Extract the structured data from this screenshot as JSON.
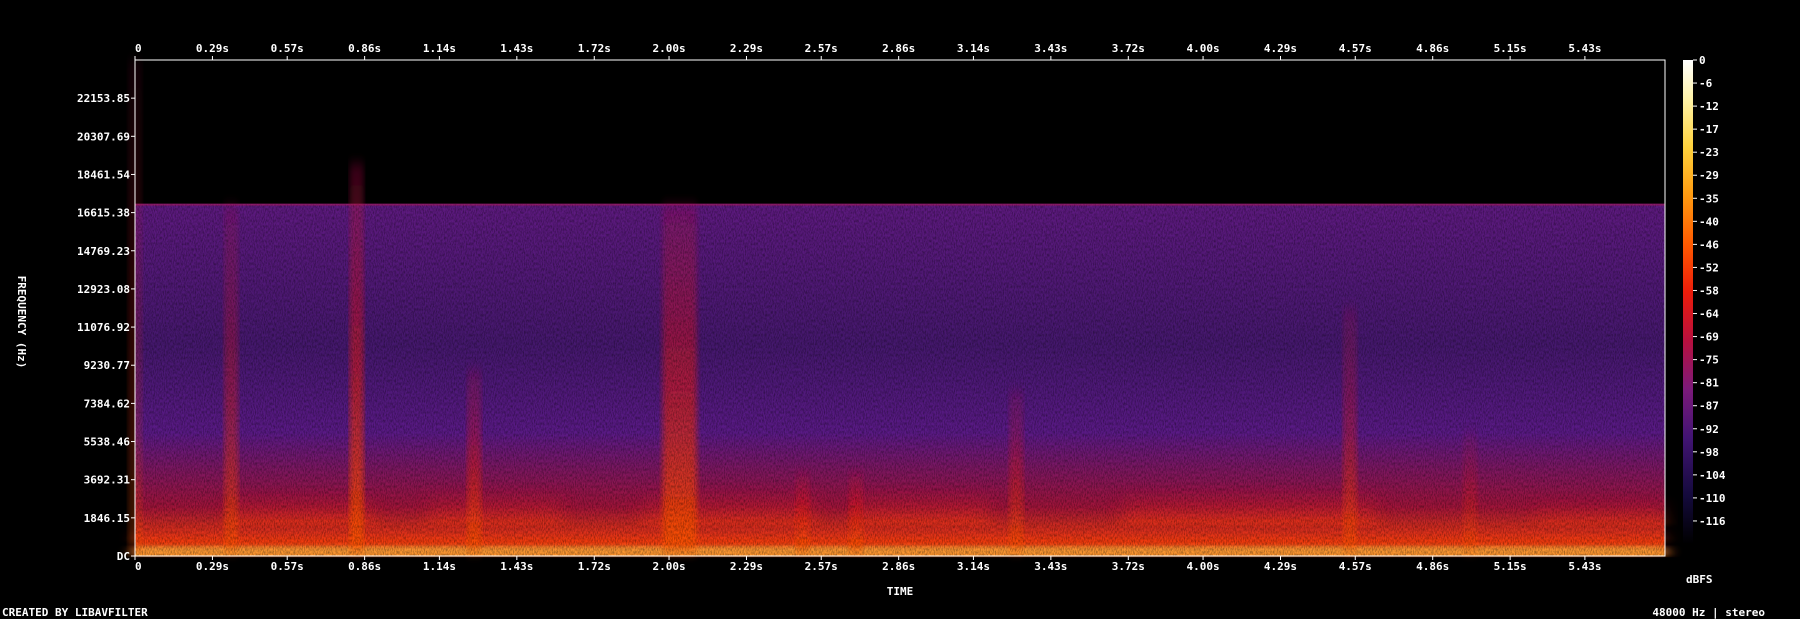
{
  "chart_data": {
    "type": "heatmap",
    "subtype": "spectrogram",
    "xlabel": "TIME",
    "ylabel": "FREQUENCY (Hz)",
    "x_ticks": [
      "0",
      "0.29s",
      "0.57s",
      "0.86s",
      "1.14s",
      "1.43s",
      "1.72s",
      "2.00s",
      "2.29s",
      "2.57s",
      "2.86s",
      "3.14s",
      "3.43s",
      "3.72s",
      "4.00s",
      "4.29s",
      "4.57s",
      "4.86s",
      "5.15s",
      "5.43s"
    ],
    "y_ticks": [
      "DC",
      "1846.15",
      "3692.31",
      "5538.46",
      "7384.62",
      "9230.77",
      "11076.92",
      "12923.08",
      "14769.23",
      "16615.38",
      "18461.54",
      "20307.69",
      "22153.85"
    ],
    "xlim": [
      0,
      5.73
    ],
    "ylim": [
      0,
      24000
    ],
    "cutoff_hz": 17000,
    "colorbar": {
      "label": "dBFS",
      "ticks": [
        "0",
        "-6",
        "-12",
        "-17",
        "-23",
        "-29",
        "-35",
        "-40",
        "-46",
        "-52",
        "-58",
        "-64",
        "-69",
        "-75",
        "-81",
        "-87",
        "-92",
        "-98",
        "-104",
        "-110",
        "-116"
      ],
      "colors": [
        "#ffffff",
        "#fff3a8",
        "#ffd23c",
        "#ff9a10",
        "#ff5a00",
        "#ec1c0a",
        "#b8103e",
        "#7c1a7a",
        "#421474",
        "#140a3c",
        "#000000"
      ]
    },
    "events": [
      {
        "t": 0.0,
        "fmax": 24000,
        "level": -60
      },
      {
        "t": 0.36,
        "fmax": 17000,
        "level": -50
      },
      {
        "t": 0.83,
        "fmax": 19000,
        "level": -40
      },
      {
        "t": 1.27,
        "fmax": 9000,
        "level": -45
      },
      {
        "t": 2.04,
        "fmax": 17000,
        "level": -40
      },
      {
        "t": 2.5,
        "fmax": 4000,
        "level": -40
      },
      {
        "t": 2.7,
        "fmax": 4000,
        "level": -38
      },
      {
        "t": 3.3,
        "fmax": 8000,
        "level": -50
      },
      {
        "t": 4.55,
        "fmax": 12000,
        "level": -50
      },
      {
        "t": 5.0,
        "fmax": 6000,
        "level": -55
      }
    ]
  },
  "footer": {
    "credit": "CREATED BY LIBAVFILTER",
    "format": "48000 Hz | stereo"
  }
}
